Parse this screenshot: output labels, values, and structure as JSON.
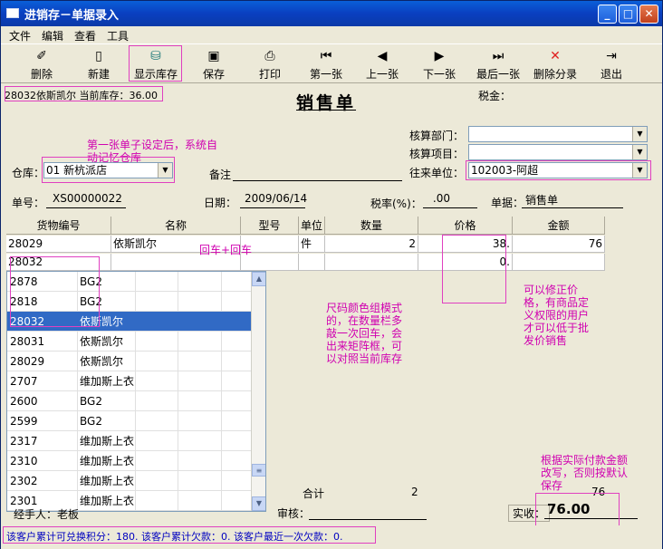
{
  "window": {
    "title": "进销存－单据录入"
  },
  "menu": [
    "文件",
    "编辑",
    "查看",
    "工具"
  ],
  "toolbar": [
    {
      "label": "删除",
      "icon": "eraser-icon",
      "glyph": "✐"
    },
    {
      "label": "新建",
      "icon": "new-document-icon",
      "glyph": "▯"
    },
    {
      "label": "显示库存",
      "icon": "stock-icon",
      "glyph": "⛁"
    },
    {
      "label": "保存",
      "icon": "save-icon",
      "glyph": "▣"
    },
    {
      "label": "打印",
      "icon": "printer-icon",
      "glyph": "⎙"
    },
    {
      "label": "第一张",
      "icon": "first-record-icon",
      "glyph": "⏮"
    },
    {
      "label": "上一张",
      "icon": "previous-record-icon",
      "glyph": "◀"
    },
    {
      "label": "下一张",
      "icon": "next-record-icon",
      "glyph": "▶"
    },
    {
      "label": "最后一张",
      "icon": "last-record-icon",
      "glyph": "⏭"
    },
    {
      "label": "删除分录",
      "icon": "delete-entry-icon",
      "glyph": "✕"
    },
    {
      "label": "退出",
      "icon": "exit-icon",
      "glyph": "⇥"
    }
  ],
  "header": {
    "stock_info": "28032依斯凯尔 当前库存：36.00",
    "doc_title": "销售单",
    "tax_label": "税金：",
    "dept_label": "核算部门：",
    "project_label": "核算项目：",
    "warehouse_label": "仓库：",
    "warehouse_value": "01 新杭派店",
    "remark_label": "备注",
    "partner_label": "往来单位：",
    "partner_value": "102003-阿超",
    "docno_label": "单号：",
    "docno_value": "XS00000022",
    "date_label": "日期：",
    "date_value": "2009/06/14",
    "taxrate_label": "税率(%)：",
    "taxrate_value": ".00",
    "doctype_label": "单据：",
    "doctype_value": "销售单"
  },
  "notes": {
    "remember_warehouse": "第一张单子设定后，系统自动记忆仓库",
    "enter_enter": "回车+回车",
    "size_color": "尺码颜色组模式的，在数量栏多敲一次回车，会出来矩阵框，可以对照当前库存",
    "modify_price": "可以修正价格，有商品定义权限的用户才可以低于批发价销售",
    "actual_pay": "根据实际付款金额改写，否则按默认保存"
  },
  "grid": {
    "headers": [
      "货物编号",
      "名称",
      "型号",
      "单位",
      "数量",
      "价格",
      "金额"
    ],
    "rows": [
      [
        "28029",
        "依斯凯尔",
        "",
        "件",
        "2",
        "38.",
        "76"
      ],
      [
        "28032",
        "",
        "",
        "",
        "",
        "0.",
        ""
      ]
    ]
  },
  "popup": {
    "rows": [
      [
        "2878",
        "BG2"
      ],
      [
        "2818",
        "BG2"
      ],
      [
        "28032",
        "依斯凯尔"
      ],
      [
        "28031",
        "依斯凯尔"
      ],
      [
        "28029",
        "依斯凯尔"
      ],
      [
        "2707",
        "维加斯上衣"
      ],
      [
        "2600",
        "BG2"
      ],
      [
        "2599",
        "BG2"
      ],
      [
        "2317",
        "维加斯上衣"
      ],
      [
        "2310",
        "维加斯上衣"
      ],
      [
        "2302",
        "维加斯上衣"
      ],
      [
        "2301",
        "维加斯上衣"
      ]
    ],
    "selected_index": 2
  },
  "footer": {
    "total_label": "合计",
    "total_qty": "2",
    "total_amount": "76",
    "operator_label": "经手人：老板",
    "auditor_label": "审核：",
    "paid_label": "实收：",
    "paid_value": "76.00",
    "status_text": "该客户累计可兑换积分：180. 该客户累计欠款：0. 该客户最近一次欠款：0."
  }
}
